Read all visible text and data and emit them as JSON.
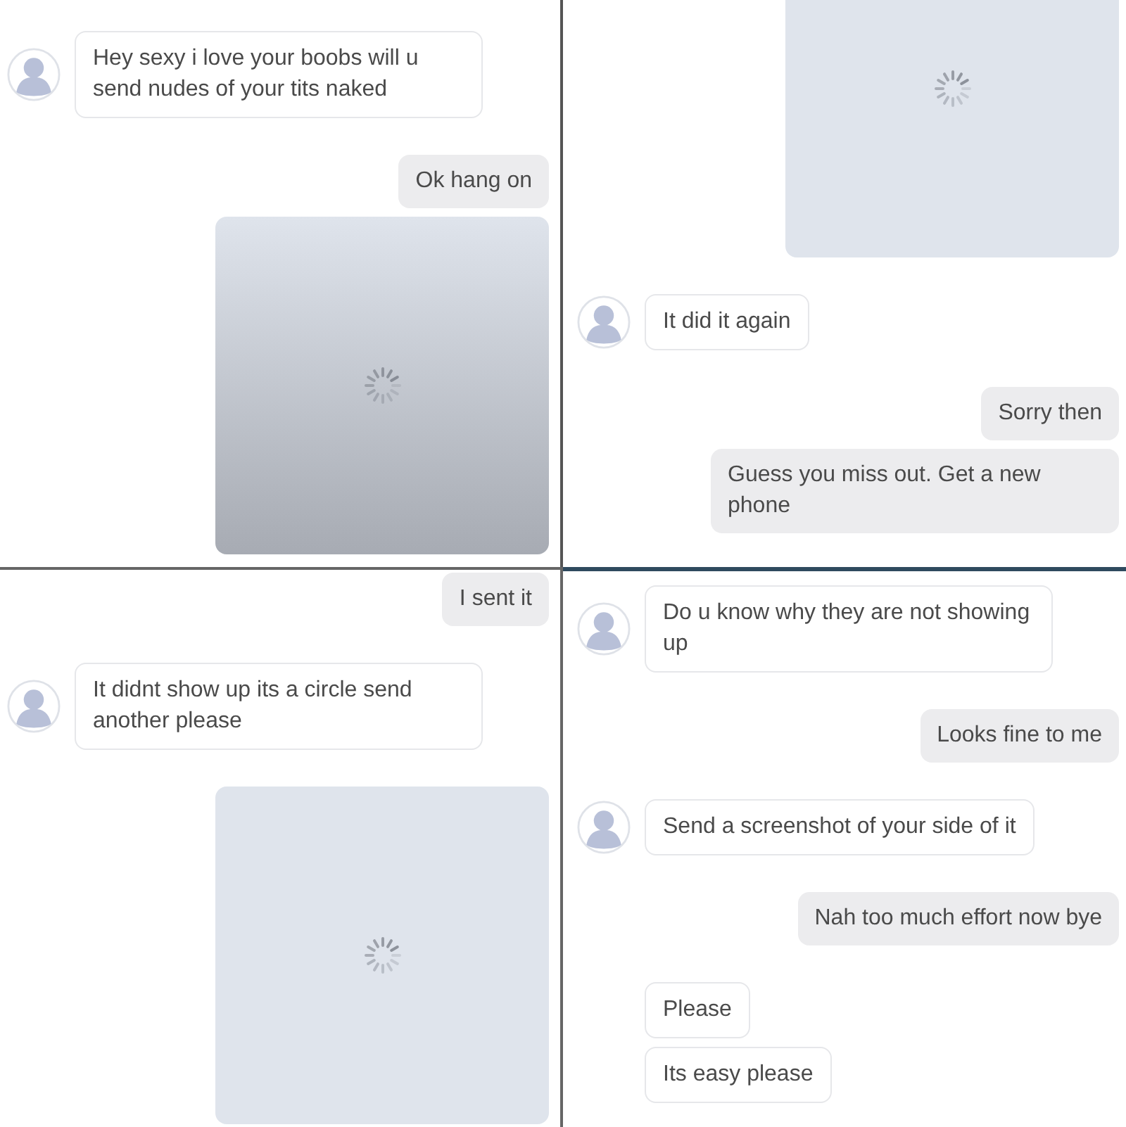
{
  "panels": [
    {
      "messages": [
        {
          "kind": "incoming",
          "avatar": true,
          "text": "Hey sexy i love your boobs will u send nudes of your tits naked"
        },
        {
          "kind": "outgoing",
          "text": "Ok hang on"
        },
        {
          "kind": "outgoing_image"
        }
      ]
    },
    {
      "messages": [
        {
          "kind": "outgoing_image"
        },
        {
          "kind": "incoming",
          "avatar": true,
          "text": "It did it again"
        },
        {
          "kind": "outgoing",
          "text": "Sorry then"
        },
        {
          "kind": "outgoing",
          "text": "Guess you miss out. Get a new phone"
        }
      ]
    },
    {
      "messages": [
        {
          "kind": "outgoing",
          "text": "I sent it"
        },
        {
          "kind": "incoming",
          "avatar": true,
          "text": "It didnt show up its a circle send another please"
        },
        {
          "kind": "outgoing_image"
        }
      ]
    },
    {
      "messages": [
        {
          "kind": "incoming",
          "avatar": true,
          "text": "Do u know why they are not showing up"
        },
        {
          "kind": "outgoing",
          "text": "Looks fine to me"
        },
        {
          "kind": "incoming",
          "avatar": true,
          "text": "Send a screenshot of your side of it"
        },
        {
          "kind": "outgoing",
          "text": "Nah too much effort now bye"
        },
        {
          "kind": "incoming",
          "avatar": false,
          "text": "Please"
        },
        {
          "kind": "incoming",
          "avatar": false,
          "text": "Its easy please"
        }
      ]
    }
  ]
}
